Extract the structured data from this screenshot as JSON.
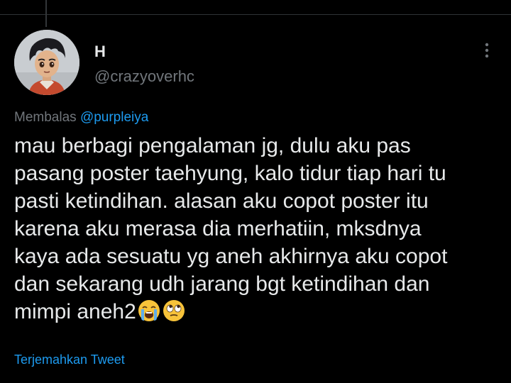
{
  "tweet": {
    "author": {
      "display_name": "H",
      "handle": "@crazyoverhc",
      "avatar": "animated-boy-avatar"
    },
    "reply_context": {
      "prefix": "Membalas",
      "mention": "@purpleiya"
    },
    "text_lines": [
      "mau berbagi pengalaman jg, dulu aku pas",
      "pasang poster taehyung, kalo tidur tiap hari tu",
      "pasti ketindihan. alasan aku copot poster itu",
      "karena aku merasa dia merhatiin, mksdnya",
      "kaya ada sesuatu yg aneh akhirnya aku copot",
      "dan sekarang udh jarang bgt ketindihan dan",
      "mimpi aneh2"
    ],
    "emojis": [
      "loudly-crying-face",
      "face-with-rolling-eyes"
    ],
    "translate_label": "Terjemahkan Tweet"
  },
  "icons": {
    "more": "vertical-ellipsis-icon"
  },
  "colors": {
    "background": "#000000",
    "primary_text": "#e7e9ea",
    "secondary_text": "#71767b",
    "accent": "#1d9bf0"
  }
}
